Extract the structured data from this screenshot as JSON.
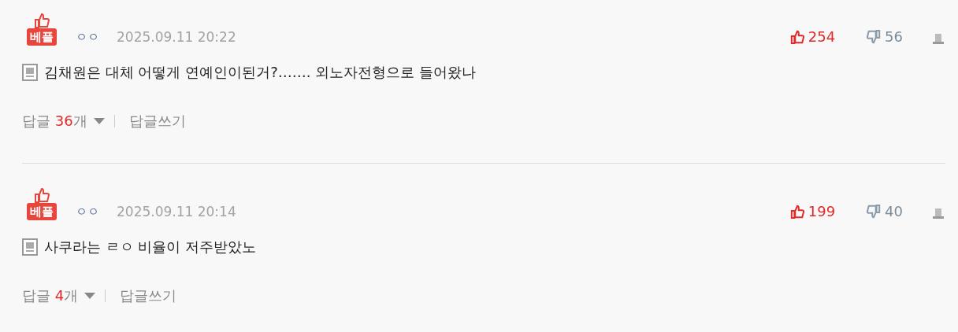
{
  "comments": [
    {
      "badge": "베플",
      "author": "ㅇㅇ",
      "date": "2025.09.11 20:22",
      "likes": "254",
      "dislikes": "56",
      "text": "김채원은 대체 어떻게 연예인이된거?……. 외노자전형으로 들어왔나",
      "reply_label": "답글",
      "reply_count": "36",
      "reply_unit": "개",
      "write_reply": "답글쓰기"
    },
    {
      "badge": "베플",
      "author": "ㅇㅇ",
      "date": "2025.09.11 20:14",
      "likes": "199",
      "dislikes": "40",
      "text": "사쿠라는 ㄹㅇ 비율이 저주받았노",
      "reply_label": "답글",
      "reply_count": "4",
      "reply_unit": "개",
      "write_reply": "답글쓰기"
    }
  ]
}
